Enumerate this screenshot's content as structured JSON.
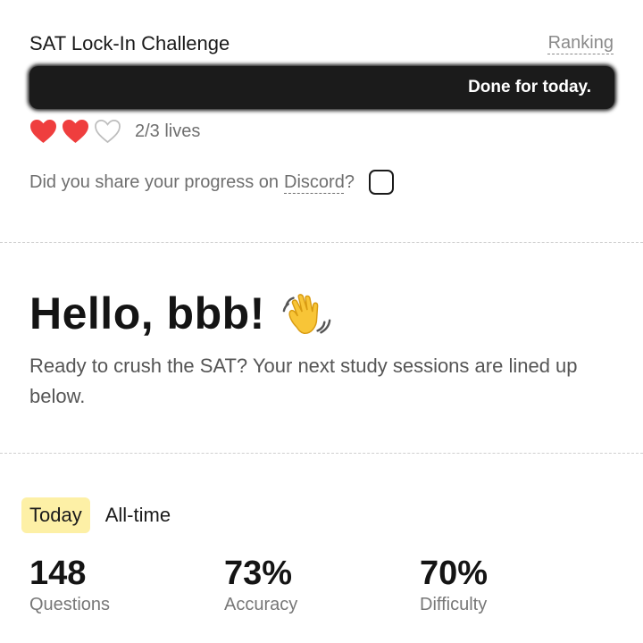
{
  "header": {
    "title": "SAT Lock-In Challenge",
    "ranking_label": "Ranking"
  },
  "progress": {
    "label": "Done for today.",
    "fraction": 1.0,
    "color": "#1b1b1b"
  },
  "lives": {
    "filled": 2,
    "total": 3,
    "text": "2/3 lives",
    "heart_color": "#ef3e3e",
    "hearts": [
      {
        "icon": "heart-filled-icon"
      },
      {
        "icon": "heart-filled-icon"
      },
      {
        "icon": "heart-outline-icon"
      }
    ]
  },
  "share": {
    "prefix": "Did you share your progress on",
    "link_label": "Discord",
    "suffix": "?",
    "checked": false
  },
  "greeting": {
    "text": "Hello, bbb!",
    "icon": "waving-hand-icon",
    "subtitle": "Ready to crush the SAT? Your next study sessions are lined up below."
  },
  "tabs": [
    {
      "label": "Today",
      "active": true
    },
    {
      "label": "All-time",
      "active": false
    }
  ],
  "stats": [
    {
      "value": "148",
      "label": "Questions"
    },
    {
      "value": "73%",
      "label": "Accuracy"
    },
    {
      "value": "70%",
      "label": "Difficulty"
    }
  ],
  "colors": {
    "tab_highlight": "#fdf0a6",
    "divider": "#cfcfcf"
  }
}
